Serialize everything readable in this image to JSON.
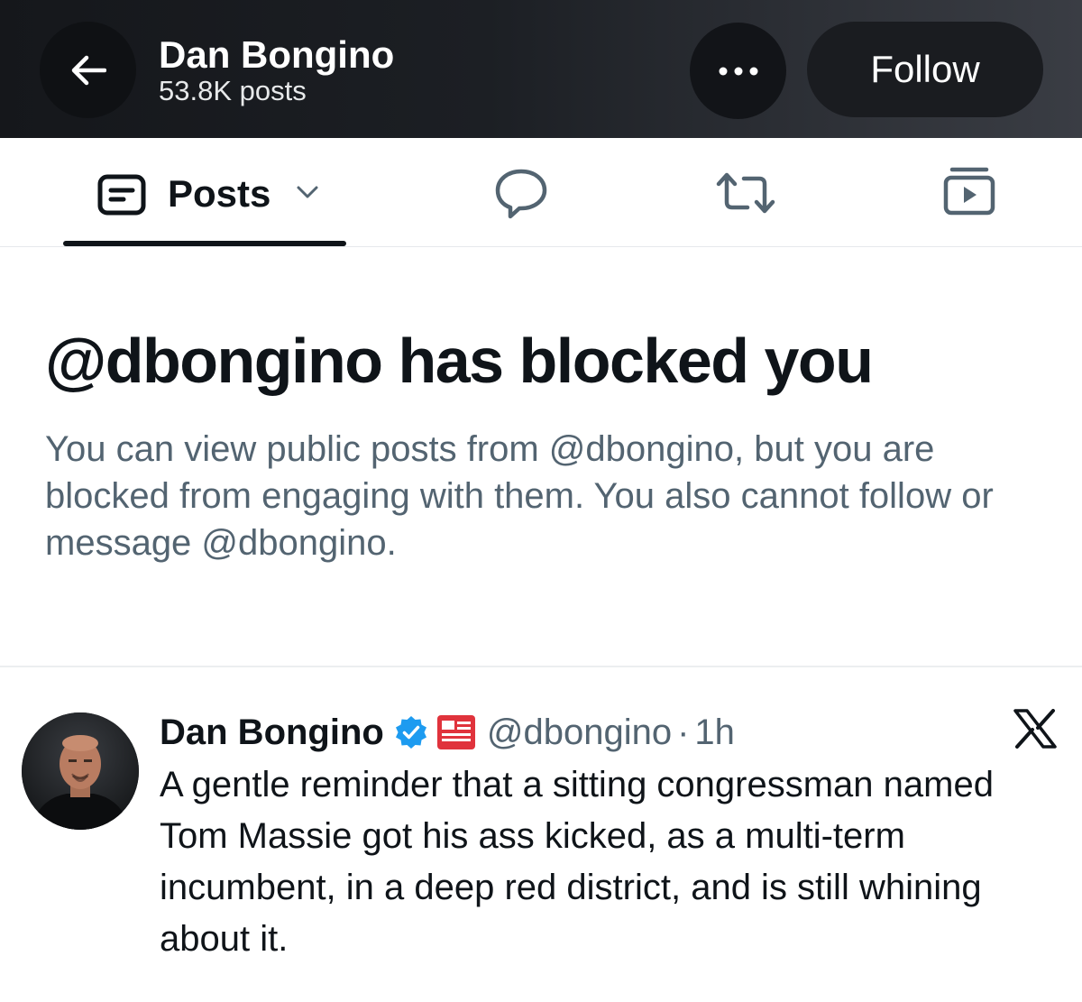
{
  "header": {
    "title": "Dan Bongino",
    "subtitle": "53.8K posts",
    "follow_label": "Follow"
  },
  "tabs": [
    {
      "label": "Posts",
      "icon": "posts-icon",
      "active": true
    },
    {
      "label": "",
      "icon": "reply-icon"
    },
    {
      "label": "",
      "icon": "repost-icon"
    },
    {
      "label": "",
      "icon": "media-icon"
    }
  ],
  "blocked": {
    "title": "@dbongino has blocked you",
    "description": "You can view public posts from @dbongino, but you are blocked from engaging with them. You also cannot follow or message @dbongino."
  },
  "tweet": {
    "author_name": "Dan Bongino",
    "handle": "@dbongino",
    "separator": "·",
    "time": "1h",
    "text": "A gentle reminder that a sitting congressman named Tom Massie got his ass kicked, as a multi-term incumbent, in a deep red district, and is still whining about it."
  },
  "colors": {
    "header_bg": "#1c1f24",
    "secondary_text": "#536471",
    "verified_blue": "#1d9bf0",
    "affiliate_red": "#e0333c"
  }
}
